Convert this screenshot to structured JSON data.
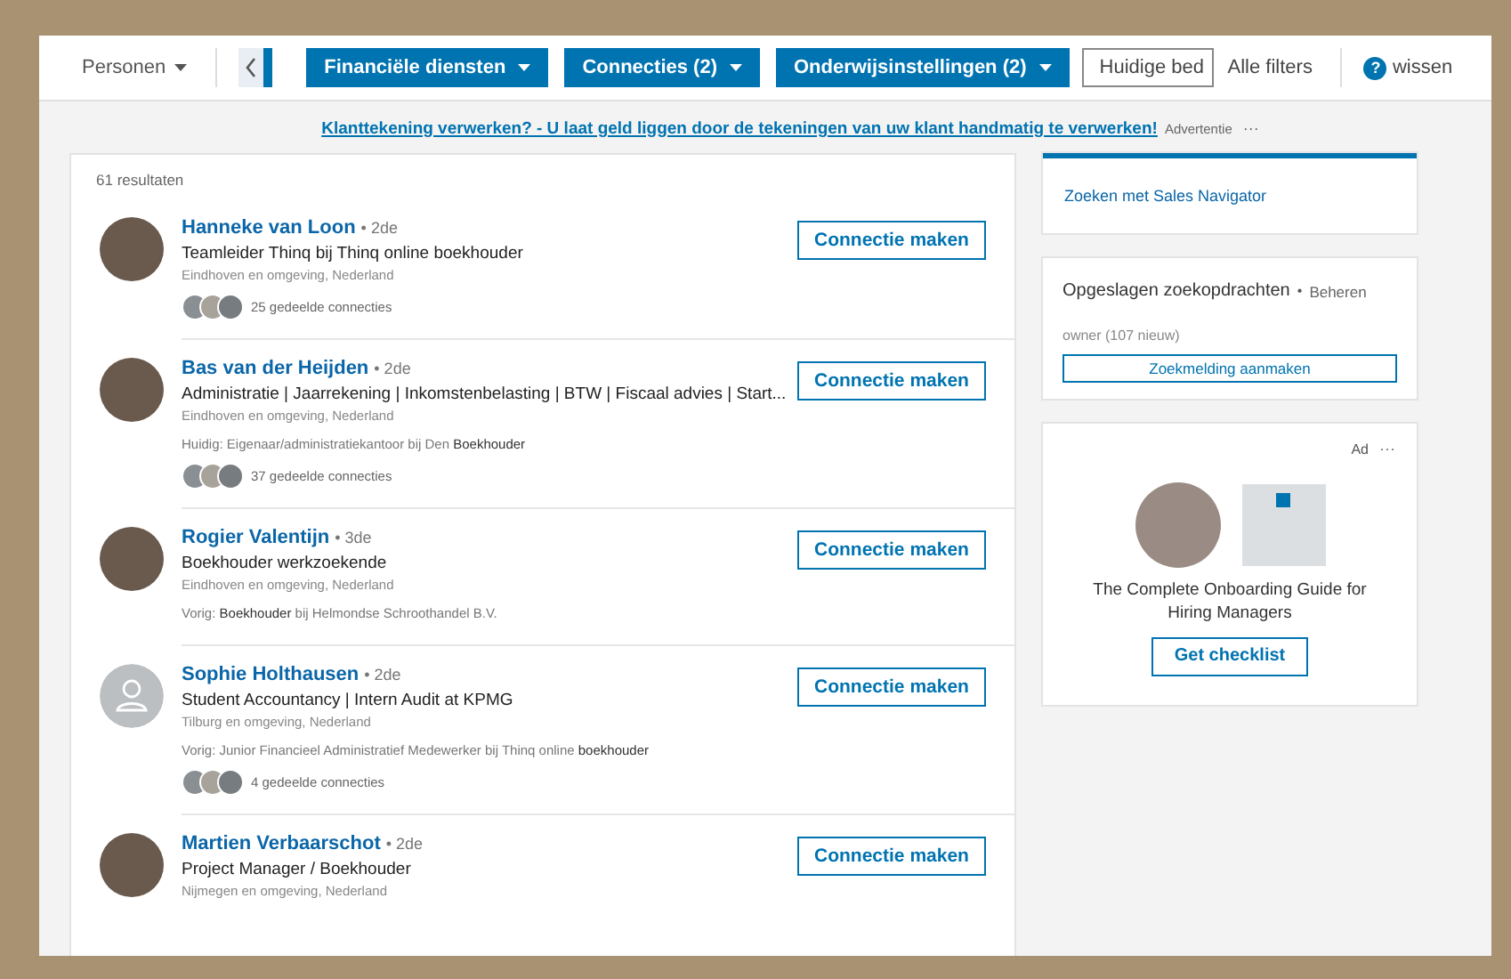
{
  "top_bar": {
    "people_menu": "Personen",
    "filters": [
      "Financiële diensten",
      "Connecties (2)",
      "Onderwijsinstellingen (2)"
    ],
    "cut_filter": "Huidige bed",
    "all_filters": "Alle filters",
    "help_icon": "?",
    "clear": "wissen"
  },
  "ad_banner": {
    "link": "Klanttekening verwerken? - U laat geld liggen door de tekeningen van uw klant handmatig te verwerken!",
    "label": "Advertentie",
    "more": "···"
  },
  "results": {
    "count": "61 resultaten",
    "people": [
      {
        "name": "Hanneke van Loon",
        "degree": "• 2de",
        "headline": "Teamleider Thinq bij Thinq online boekhouder",
        "location": "Eindhoven en omgeving, Nederland",
        "kind": "photo",
        "shared": "25 gedeelde connecties",
        "button": "Connectie maken"
      },
      {
        "name": "Bas van der Heijden",
        "degree": "• 2de",
        "headline": "Administratie | Jaarrekening | Inkomstenbelasting | BTW | Fiscaal advies | Start...",
        "location": "Eindhoven en omgeving, Nederland",
        "detail": "Huidig: Eigenaar/administratiekantoor bij Den **Boekhouder**",
        "kind": "photo",
        "shared": "37 gedeelde connecties",
        "button": "Connectie maken"
      },
      {
        "name": "Rogier Valentijn",
        "degree": "• 3de",
        "headline": "Boekhouder werkzoekende",
        "location": "Eindhoven en omgeving, Nederland",
        "detail": "Vorig: **Boekhouder** bij Helmondse Schroothandel B.V.",
        "kind": "photo",
        "button": "Connectie maken"
      },
      {
        "name": "Sophie Holthausen",
        "degree": "• 2de",
        "headline": "Student Accountancy | Intern Audit at KPMG",
        "location": "Tilburg en omgeving, Nederland",
        "detail": "Vorig: Junior Financieel Administratief Medewerker bij Thinq online **boekhouder**",
        "kind": "placeholder",
        "shared": "4 gedeelde connecties",
        "button": "Connectie maken"
      },
      {
        "name": "Martien Verbaarschot",
        "degree": "• 2de",
        "headline": "Project Manager / Boekhouder",
        "location": "Nijmegen en omgeving, Nederland",
        "kind": "photo",
        "button": "Connectie maken"
      }
    ]
  },
  "sidebar": {
    "sales_navigator": "Zoeken met Sales Navigator",
    "saved_searches": {
      "title": "Opgeslagen zoekopdrachten",
      "separator": "•",
      "manage": "Beheren",
      "item": "owner (107 nieuw)",
      "button": "Zoekmelding aanmaken"
    },
    "ad": {
      "label": "Ad",
      "more": "···",
      "text": "The Complete Onboarding Guide for Hiring Managers",
      "button": "Get checklist"
    }
  }
}
